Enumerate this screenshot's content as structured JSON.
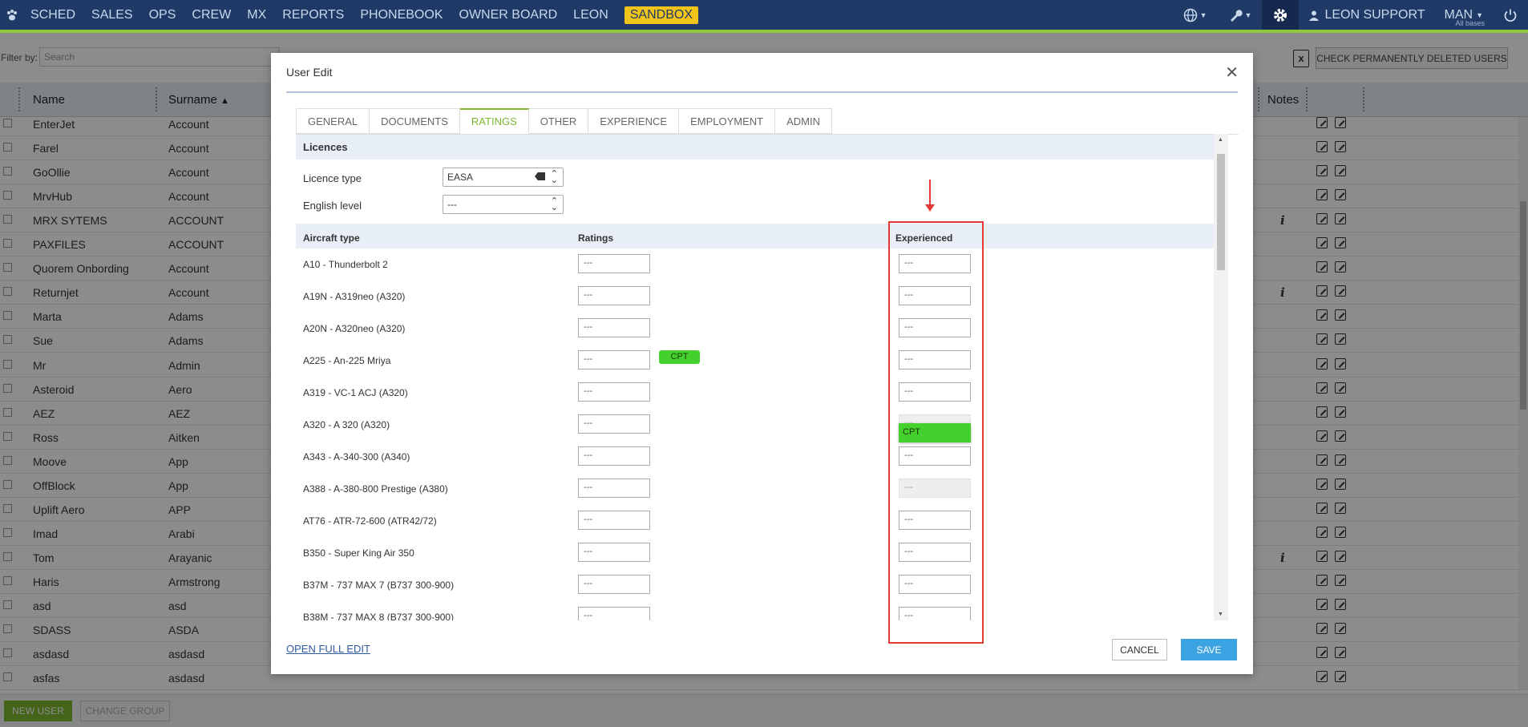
{
  "nav": {
    "items": [
      "SCHED",
      "SALES",
      "OPS",
      "CREW",
      "MX",
      "REPORTS",
      "PHONEBOOK",
      "OWNER BOARD",
      "LEON"
    ],
    "sandbox": "SANDBOX",
    "user": "LEON SUPPORT",
    "base": "MAN",
    "base_sub": "All bases"
  },
  "filter": {
    "label": "Filter by:",
    "search_placeholder": "Search"
  },
  "toolbar": {
    "check_deleted": "CHECK PERMANENTLY DELETED USERS"
  },
  "table": {
    "headers": {
      "name": "Name",
      "surname": "Surname",
      "notes": "Notes"
    },
    "rows": [
      {
        "name": "EnterJet",
        "surname": "Account",
        "info": false
      },
      {
        "name": "Farel",
        "surname": "Account",
        "info": false
      },
      {
        "name": "GoOllie",
        "surname": "Account",
        "info": false
      },
      {
        "name": "MrvHub",
        "surname": "Account",
        "info": false
      },
      {
        "name": "MRX SYTEMS",
        "surname": "ACCOUNT",
        "info": true
      },
      {
        "name": "PAXFILES",
        "surname": "ACCOUNT",
        "info": false
      },
      {
        "name": "Quorem Onbording",
        "surname": "Account",
        "info": false
      },
      {
        "name": "Returnjet",
        "surname": "Account",
        "info": true
      },
      {
        "name": "Marta",
        "surname": "Adams",
        "info": false
      },
      {
        "name": "Sue",
        "surname": "Adams",
        "info": false
      },
      {
        "name": "Mr",
        "surname": "Admin",
        "info": false
      },
      {
        "name": "Asteroid",
        "surname": "Aero",
        "info": false
      },
      {
        "name": "AEZ",
        "surname": "AEZ",
        "info": false
      },
      {
        "name": "Ross",
        "surname": "Aitken",
        "info": false
      },
      {
        "name": "Moove",
        "surname": "App",
        "info": false
      },
      {
        "name": "OffBlock",
        "surname": "App",
        "info": false
      },
      {
        "name": "Uplift Aero",
        "surname": "APP",
        "info": false
      },
      {
        "name": "Imad",
        "surname": "Arabi",
        "info": false
      },
      {
        "name": "Tom",
        "surname": "Arayanic",
        "info": true
      },
      {
        "name": "Haris",
        "surname": "Armstrong",
        "info": false
      },
      {
        "name": "asd",
        "surname": "asd",
        "info": false
      },
      {
        "name": "SDASS",
        "surname": "ASDA",
        "info": false
      },
      {
        "name": "asdasd",
        "surname": "asdasd",
        "info": false
      },
      {
        "name": "asfas",
        "surname": "asdasd",
        "info": false
      }
    ]
  },
  "bottom": {
    "new_user": "NEW USER",
    "change_group": "CHANGE GROUP"
  },
  "modal": {
    "title": "User Edit",
    "tabs": [
      "GENERAL",
      "DOCUMENTS",
      "RATINGS",
      "OTHER",
      "EXPERIENCE",
      "EMPLOYMENT",
      "ADMIN"
    ],
    "active_tab": "RATINGS",
    "licences_header": "Licences",
    "licence_type_label": "Licence type",
    "licence_type_value": "EASA",
    "english_level_label": "English level",
    "english_level_value": "---",
    "columns": {
      "aircraft": "Aircraft type",
      "ratings": "Ratings",
      "experienced": "Experienced"
    },
    "aircraft": [
      {
        "label": "A10 - Thunderbolt 2",
        "rating": "---",
        "badge": "",
        "experienced": "---",
        "exp_disabled": false
      },
      {
        "label": "A19N - A319neo (A320)",
        "rating": "---",
        "badge": "",
        "experienced": "---",
        "exp_disabled": false
      },
      {
        "label": "A20N - A320neo (A320)",
        "rating": "---",
        "badge": "",
        "experienced": "---",
        "exp_disabled": false
      },
      {
        "label": "A225 - An-225 Mriya",
        "rating": "---",
        "badge": "CPT",
        "experienced": "---",
        "exp_disabled": false
      },
      {
        "label": "A319 - VC-1 ACJ (A320)",
        "rating": "---",
        "badge": "",
        "experienced": "---",
        "exp_disabled": false
      },
      {
        "label": "A320 - A 320 (A320)",
        "rating": "---",
        "badge": "",
        "experienced": "---",
        "exp_disabled": true
      },
      {
        "label": "A343 - A-340-300 (A340)",
        "rating": "---",
        "badge": "",
        "experienced": "---",
        "exp_disabled": false
      },
      {
        "label": "A388 - A-380-800 Prestige (A380)",
        "rating": "---",
        "badge": "",
        "experienced": "---",
        "exp_disabled": true
      },
      {
        "label": "AT76 - ATR-72-600 (ATR42/72)",
        "rating": "---",
        "badge": "",
        "experienced": "---",
        "exp_disabled": false
      },
      {
        "label": "B350 - Super King Air 350",
        "rating": "---",
        "badge": "",
        "experienced": "---",
        "exp_disabled": false
      },
      {
        "label": "B37M - 737 MAX 7 (B737 300-900)",
        "rating": "---",
        "badge": "",
        "experienced": "---",
        "exp_disabled": false
      },
      {
        "label": "B38M - 737 MAX 8 (B737 300-900)",
        "rating": "---",
        "badge": "",
        "experienced": "---",
        "exp_disabled": false
      }
    ],
    "dropdown_option": "CPT",
    "open_full_edit": "OPEN FULL EDIT",
    "cancel": "CANCEL",
    "save": "SAVE"
  },
  "colors": {
    "nav_bg": "#1f3a66",
    "accent_green": "#7cb82f",
    "badge_green": "#45d12d",
    "save_blue": "#3ca3e3",
    "annotation_red": "#e53935"
  }
}
